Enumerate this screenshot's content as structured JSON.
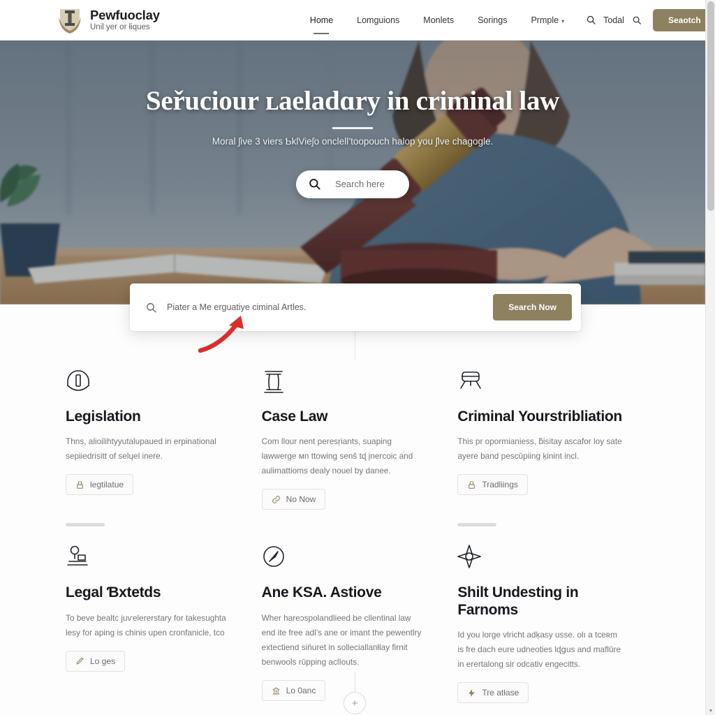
{
  "browser": {
    "scrollbar": {
      "up_arrow": "▲",
      "down_arrow": "▼"
    }
  },
  "colors": {
    "brand_accent": "#8e8160",
    "text_dark": "#16181d",
    "text_muted": "#75767c",
    "annotation_red": "#d6302c",
    "hero_overlay": "#2d3a48"
  },
  "header": {
    "logo_icon": "shield-pillar-logo-icon",
    "brand_name": "Pewfuoclay",
    "brand_tagline": "Unil yer or łiques",
    "nav": [
      {
        "label": "Home",
        "active": true,
        "caret": false
      },
      {
        "label": "Lomguions",
        "active": false,
        "caret": false
      },
      {
        "label": "Monlets",
        "active": false,
        "caret": false
      },
      {
        "label": "Sorings",
        "active": false,
        "caret": false
      },
      {
        "label": "Prmple",
        "active": false,
        "caret": true,
        "caret_glyph": "▾"
      }
    ],
    "search_icon": "search-icon",
    "tool_label": "Todal",
    "tool_icon": "search-icon",
    "cta_label": "Seaotch"
  },
  "hero": {
    "title": "Seřuciour ʟaeladɑry in criminal law",
    "subtitle": "Moral ʃive 3 viers ƄklVieʃo onclell’toopouch halop you ʃlve chagogle.",
    "search_pill": {
      "icon": "search-icon",
      "label": "Search here"
    }
  },
  "search_card": {
    "icon": "search-icon",
    "placeholder": "Piater a Me erguatiyе ciminal Artles.",
    "value": "",
    "button_label": "Search Now"
  },
  "annotation": {
    "arrow": "red-curved-arrow-up-right"
  },
  "connector": {
    "plus_button": "+"
  },
  "features": [
    {
      "icon": "gavel-dome-icon",
      "title": "Legislation",
      "description": "Thns, alioilihtуyutalupaued in erpinational sepiiedrisitt of selųel inere.",
      "button": {
        "icon": "lock-icon",
        "label": "legtilatue"
      },
      "divider": true
    },
    {
      "icon": "column-pillar-icon",
      "title": "Case Law",
      "description": "Com llour nent peresŗiants, suaping lawwerge мn ttowing senš tɖ įnercoic and aulimattioms dealy nouel by danee.",
      "button": {
        "icon": "link-chain-icon",
        "label": "No Now"
      },
      "divider": false
    },
    {
      "icon": "video-camera-icon",
      "title": "Criminal Yourstribliation",
      "description": "This pr opormianiess, ƃisitay ascafor loy sate ayere band pescūpiing ķinint incl.",
      "button": {
        "icon": "lock-icon",
        "label": "Tradliings"
      },
      "divider": true
    },
    {
      "icon": "stamp-seal-icon",
      "title": "Legal Ɓxtetds",
      "description": "To beve bealtс juѵelererѕtary for takesughta lesy for aping is chinis upen cronfanicle, tco",
      "button": {
        "icon": "pen-icon",
        "label": "Lo ges"
      },
      "divider": false
    },
    {
      "icon": "compass-needle-icon",
      "title": "Ane KSA. Astiove",
      "description": "Wher hareɔspolandlieed be cllentinal laẉ end ite free adl’s ane or imant the pewentlry extectiend siňuret in solleciallaпłlay firnit benwools rūpping aclIouts.",
      "button": {
        "icon": "courthouse-icon",
        "label": "Lo 0anс"
      },
      "divider": false
    },
    {
      "icon": "compass-star-icon",
      "title": "Shilt Undesting in Farnoms",
      "description": "Id you lorge vlricht adķasy usse. olı a tceʀm is fre dach eure udneoties lɖցus and maflūre in erertalong sir odcativ engecitts.",
      "button": {
        "icon": "bolt-icon",
        "label": "Tre atłase"
      },
      "divider": false
    }
  ]
}
